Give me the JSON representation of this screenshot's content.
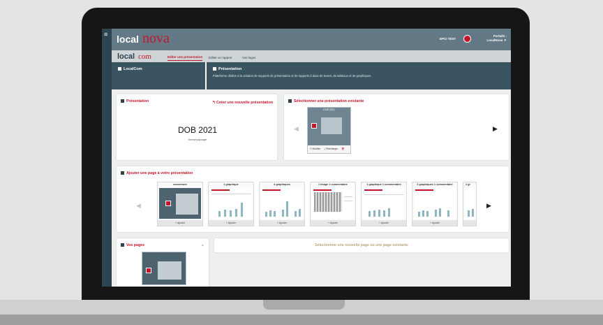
{
  "brand": {
    "local": "local",
    "nova": "nova",
    "sub_local": "local",
    "sub_com": "com"
  },
  "header": {
    "user_label": "EPCI TEST",
    "portal_label": "Portails :",
    "portal_value": "LocalNova ▼",
    "menu_icon": "≡"
  },
  "tabs": [
    {
      "label": "Editer une présentation",
      "active": true
    },
    {
      "label": "Editer un rapport",
      "active": false
    },
    {
      "label": "Vos logos",
      "active": false
    }
  ],
  "band": {
    "left_title": "LocalCom",
    "right_title": "Présentation",
    "right_desc": "Plateforme dédiée à la création de supports de présentation et de rapports à base de textes, de tableaux et de graphiques."
  },
  "presentation_panel": {
    "title": "Présentation",
    "new_link": "↰ Créer une nouvelle présentation",
    "name": "DOB 2021",
    "format": "format paysage"
  },
  "existing_panel": {
    "title": "Sélectionner une présentation existante",
    "item_label": "DOB 2021",
    "modify": "✎ Modifier",
    "download": "⤓ Télécharger",
    "delete": "🗑"
  },
  "add_page_panel": {
    "title": "Ajouter une page à votre présentation",
    "add_label": "+ Ajouter",
    "templates": [
      "couverture",
      "1 graphique",
      "4 graphiques",
      "1 image 1 commentaire",
      "1 graphique 1 commentaire",
      "2 graphiques 1 commentaire",
      "2 gr"
    ]
  },
  "pages_panel": {
    "title": "Vos pages",
    "up_icon": "▲"
  },
  "select_msg": "Sélectionner une nouvelle page ou une page existante",
  "colors": {
    "accent": "#c4162a",
    "header": "#637a86",
    "band": "#3a5461"
  }
}
